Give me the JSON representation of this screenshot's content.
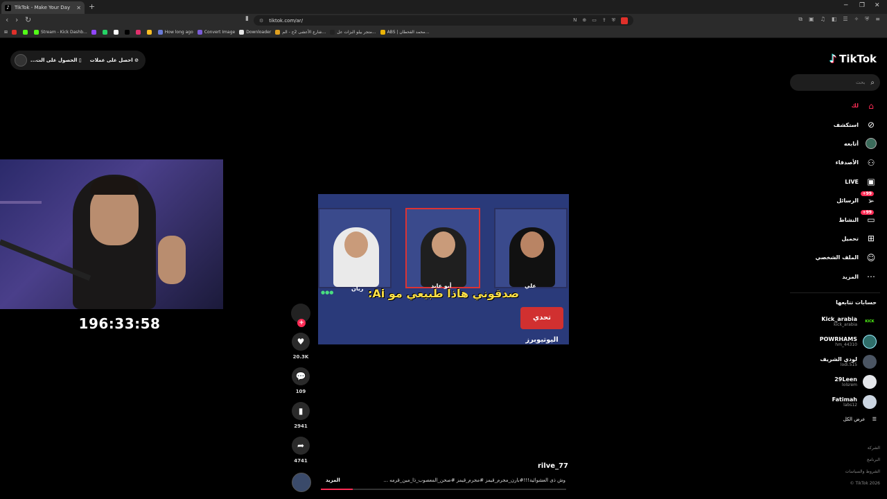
{
  "browser": {
    "tab_title": "TikTok - Make Your Day",
    "url": "tiktok.com/ar/",
    "bookmarks": [
      {
        "label": "",
        "color": "#e0302a"
      },
      {
        "label": "",
        "color": "#53fc18"
      },
      {
        "label": "Stream - Kick Dashb...",
        "color": "#53fc18"
      },
      {
        "label": "",
        "color": "#9146ff"
      },
      {
        "label": "",
        "color": "#25d366"
      },
      {
        "label": "",
        "color": "#ffffff"
      },
      {
        "label": "",
        "color": "#000000"
      },
      {
        "label": "",
        "color": "#e1306c"
      },
      {
        "label": "",
        "color": "#fbbf24"
      },
      {
        "label": "How long ago",
        "color": "#6a7bd8"
      },
      {
        "label": "Convert Image",
        "color": "#7a5cd8"
      },
      {
        "label": "Downloader",
        "color": "#e5e5e5"
      },
      {
        "label": "شارع الأعشى 2ج - الم...",
        "color": "#e0a020"
      },
      {
        "label": "متجر بيلو البزات عل...",
        "color": "#222222"
      },
      {
        "label": "ABS | محمد القحطان...",
        "color": "#eab308"
      }
    ]
  },
  "get_app": {
    "labels": [
      "احصل على عملات",
      "الحصول على الت..."
    ]
  },
  "stream_overlay": {
    "timer": "196:33:58"
  },
  "video": {
    "caption": "صدقوني هاذا طبيعي مو Ai:",
    "names": [
      "ريان",
      "أبو عابد",
      "علي"
    ],
    "logo_text": "تحدي اليوتيوبرز",
    "author": "rilve_77",
    "description": "وش ذى العشوائية!!!#بارن_مجرم_قيمز #مجرم_قيمز #صحن_المعصوب_ذا_مين_قرمه ...",
    "more_label": "المزيد",
    "progress": 0.13,
    "likes": "20.3K",
    "comments": "109",
    "saves": "2941",
    "shares": "4741"
  },
  "nav": {
    "logo": "TikTok",
    "search_placeholder": "بحث",
    "items": [
      {
        "label": "لك",
        "icon": "home-icon",
        "active": true,
        "badge": ""
      },
      {
        "label": "استكشف",
        "icon": "compass-icon",
        "active": false,
        "badge": ""
      },
      {
        "label": "أتابعه",
        "icon": "avatar-icon",
        "active": false,
        "badge": ""
      },
      {
        "label": "الأصدقاء",
        "icon": "friends-icon",
        "active": false,
        "badge": ""
      },
      {
        "label": "LIVE",
        "icon": "live-icon",
        "active": false,
        "badge": ""
      },
      {
        "label": "الرسائل",
        "icon": "messages-icon",
        "active": false,
        "badge": "+99"
      },
      {
        "label": "النشاط",
        "icon": "activity-icon",
        "active": false,
        "badge": "+99"
      },
      {
        "label": "تحميل",
        "icon": "upload-icon",
        "active": false,
        "badge": ""
      },
      {
        "label": "الملف الشخصي",
        "icon": "profile-icon",
        "active": false,
        "badge": ""
      },
      {
        "label": "المزيد",
        "icon": "more-icon",
        "active": false,
        "badge": ""
      }
    ]
  },
  "following": {
    "title": "حسابات تتابعها",
    "accounts": [
      {
        "name": "Kick_arabia",
        "handle": "kick_arabia",
        "avatar_text": "KICK",
        "color": "#53fc18"
      },
      {
        "name": "POWRHAMS",
        "handle": "hm_44310",
        "avatar_text": "",
        "color": "#2f6e6a"
      },
      {
        "name": "لودي الشريف",
        "handle": "lodi.515",
        "avatar_text": "",
        "color": "#4b5563"
      },
      {
        "name": "29Leen",
        "handle": "lolsrem",
        "avatar_text": "",
        "color": "#e5e7eb"
      },
      {
        "name": "Fatimah",
        "handle": "labs12",
        "avatar_text": "",
        "color": "#cbd5e1"
      }
    ],
    "see_all": "عرض الكل"
  },
  "footer": {
    "links": [
      "الشركة",
      "البرنامج",
      "الشروط والسياسات"
    ],
    "copyright": "© TikTok 2026"
  }
}
